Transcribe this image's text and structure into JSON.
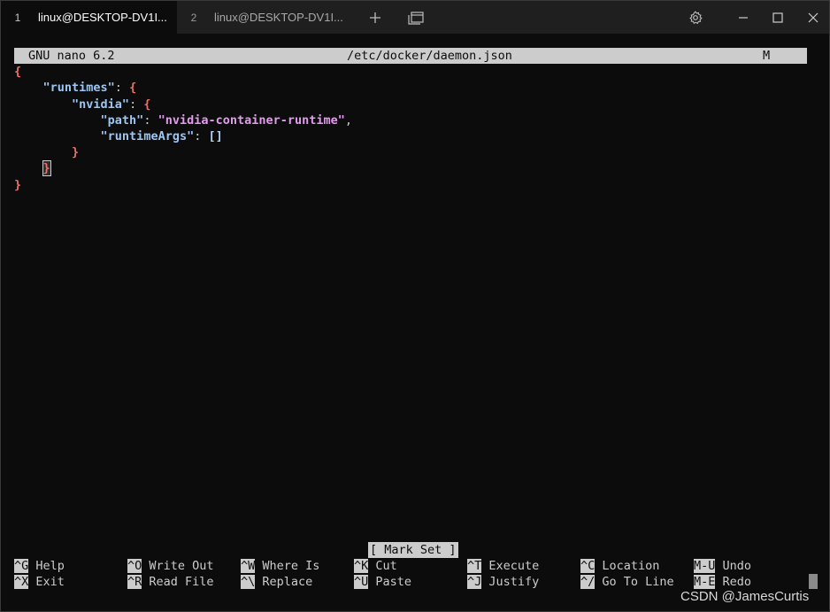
{
  "tabs": [
    {
      "number": "1",
      "title": "linux@DESKTOP-DV1I...",
      "active": true
    },
    {
      "number": "2",
      "title": "linux@DESKTOP-DV1I...",
      "active": false
    }
  ],
  "toolbar_icons": [
    "plus-icon",
    "window-overlap-icon",
    "gear-icon",
    "minimize-icon",
    "maximize-icon",
    "close-icon"
  ],
  "nano": {
    "version": "GNU nano 6.2",
    "filename": "/etc/docker/daemon.json",
    "modified_flag": "M",
    "status_message": "[ Mark Set ]"
  },
  "file": {
    "open_brace": "{",
    "runtimes_key": "\"runtimes\"",
    "nvidia_key": "\"nvidia\"",
    "path_key": "\"path\"",
    "path_value": "\"nvidia-container-runtime\"",
    "runtimeArgs_key": "\"runtimeArgs\"",
    "runtimeArgs_value": "[]",
    "inner_open": "{",
    "inner_close": "}",
    "close_brace": "}",
    "colon": ": ",
    "comma": ","
  },
  "shortcuts": [
    {
      "key": "^G",
      "label": "Help"
    },
    {
      "key": "^O",
      "label": "Write Out"
    },
    {
      "key": "^W",
      "label": "Where Is"
    },
    {
      "key": "^K",
      "label": "Cut"
    },
    {
      "key": "^T",
      "label": "Execute"
    },
    {
      "key": "^C",
      "label": "Location"
    },
    {
      "key": "M-U",
      "label": "Undo"
    },
    {
      "key": "^X",
      "label": "Exit"
    },
    {
      "key": "^R",
      "label": "Read File"
    },
    {
      "key": "^\\",
      "label": "Replace"
    },
    {
      "key": "^U",
      "label": "Paste"
    },
    {
      "key": "^J",
      "label": "Justify"
    },
    {
      "key": "^/",
      "label": "Go To Line"
    },
    {
      "key": "M-E",
      "label": "Redo"
    }
  ],
  "watermark": "CSDN @JamesCurtis",
  "colors": {
    "background": "#0c0c0c",
    "tabbar": "#1f1f1f",
    "brace": "#e8736b",
    "key": "#9cc7f4",
    "string": "#e49aef"
  }
}
